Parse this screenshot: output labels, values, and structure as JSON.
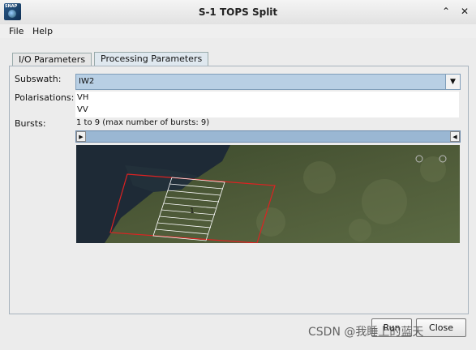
{
  "window": {
    "title": "S-1 TOPS Split",
    "minimize_icon": "minimize-icon",
    "close_icon": "close-icon",
    "app_icon_text": "SNAP"
  },
  "menu": {
    "items": [
      "File",
      "Help"
    ]
  },
  "tabs": [
    {
      "label": "I/O Parameters",
      "active": false
    },
    {
      "label": "Processing Parameters",
      "active": true
    }
  ],
  "form": {
    "subswath_label": "Subswath:",
    "subswath_value": "IW2",
    "polarisations_label": "Polarisations:",
    "polarisations": [
      "VH",
      "VV"
    ],
    "bursts_label": "Bursts:",
    "bursts_value": "1 to 9 (max number of bursts: 9)",
    "burst_marker": "1"
  },
  "buttons": {
    "run": "Run",
    "close": "Close"
  },
  "watermark": "CSDN @我睡上的蓝天",
  "colors": {
    "selection": "#b8cfe4",
    "footprint": "#dd2222",
    "bursts": "#ffffff"
  }
}
